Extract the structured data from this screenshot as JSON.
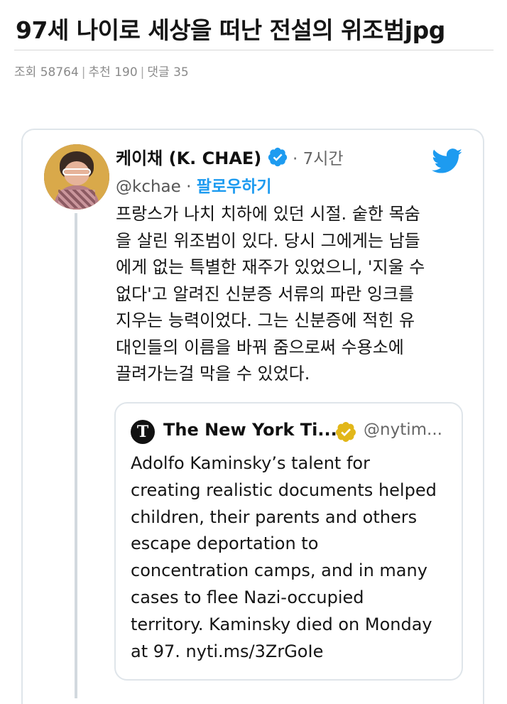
{
  "post": {
    "title": "97세 나이로 세상을 떠난 전설의 위조범jpg",
    "views_label": "조회",
    "views": "58764",
    "likes_label": "추천",
    "likes": "190",
    "comments_label": "댓글",
    "comments": "35"
  },
  "tweet": {
    "author_name": "케이채 (K. CHAE)",
    "time": "· 7시간",
    "handle": "@kchae ·",
    "follow_label": "팔로우하기",
    "body_lines": [
      "프랑스가 나치 치하에 있던 시절. 숱한 목숨",
      "을 살린 위조범이 있다. 당시 그에게는 남들",
      "에게 없는 특별한 재주가 있었으니, '지울 수",
      "없다'고 알려진 신분증 서류의 파란 잉크를",
      "지우는 능력이었다. 그는 신분증에 적힌 유",
      "대인들의 이름을 바꿔 줌으로써 수용소에",
      "끌려가는걸 막을 수 있었다."
    ],
    "icons": {
      "verified": "verified-badge-icon",
      "platform": "twitter-bird-icon"
    },
    "colors": {
      "link_blue": "#1d9bf0",
      "verified_gold": "#e2b719"
    }
  },
  "quote": {
    "name": "The New York Ti...",
    "handle": "@nytim...",
    "logo_letter": "T",
    "body_lines": [
      "Adolfo Kaminsky’s talent for",
      "creating realistic documents helped",
      "children, their parents and others",
      "escape deportation to",
      "concentration camps, and in many",
      "cases to flee Nazi-occupied",
      "territory. Kaminsky died on Monday",
      "at 97. nyti.ms/3ZrGoIe"
    ]
  }
}
